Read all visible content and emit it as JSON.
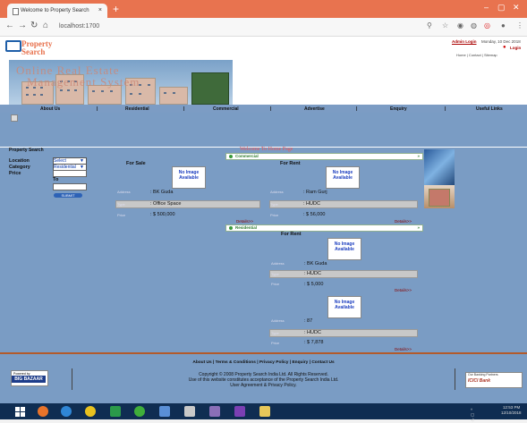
{
  "browser": {
    "tab_title": "Welcome to Property Search",
    "tab_close": "×",
    "new_tab": "+",
    "url": "localhost:1700",
    "win_min": "–",
    "win_max": "▢",
    "win_close": "✕"
  },
  "header": {
    "logo_line1": "Property",
    "logo_line2": "Search",
    "admin_login": "Admin Login",
    "date": "Monday, 10 Dec 2018",
    "login": "Login",
    "top_links": "Home  |  Contact  |  Sitemap"
  },
  "banner": {
    "title_line1": "Online Real Estate",
    "title_line2": "Management System"
  },
  "nav": {
    "items": [
      "About Us",
      "Residential",
      "Commercial",
      "Advertise",
      "Enquiry",
      "Useful Links"
    ],
    "separator": "|"
  },
  "search": {
    "title": "Property Search",
    "location_label": "Location",
    "location_value": "Select",
    "category_label": "Category",
    "category_value": "Residential",
    "price_label": "Price",
    "to_label": "To",
    "submit_label": "SUBMIT"
  },
  "main": {
    "welcome": "Welcome To Home Page",
    "commercial_label": "Commercial",
    "residential_label": "Residential",
    "close_x": "»",
    "for_sale": "For Sale",
    "for_rent": "For Rent",
    "no_image_1": "No Image",
    "no_image_2": "Available",
    "address_label": "Address",
    "type_label": "Type",
    "price_label": "Price",
    "details": "Details>>",
    "commercial_sale": {
      "address": ": BK Guda",
      "type": ": Office Space",
      "price": ": $ 500,000"
    },
    "commercial_rent": {
      "address": ": Ram Gurj",
      "type": ": HUDC",
      "price": ": $ 56,000"
    },
    "residential_rent1": {
      "address": ": BK Guda",
      "type": ": HUDC",
      "price": ": $ 5,000"
    },
    "residential_rent2": {
      "address": ": 87",
      "type": ": HUDC",
      "price": ": $ 7,878"
    }
  },
  "footer": {
    "links": "About Us  |  Terms & Conditions  |  Privacy Policy  |  Enquiry  |  Contact Us",
    "copyright1": "Copyright © 2008 Property Search India Ltd. All Rights Reserved.",
    "copyright2": "Use of this website constitutes acceptance of the Property Search India Ltd.",
    "copyright3": "User Agreement & Privacy Policy.",
    "powered_by": "Powered by",
    "big_bazaar": "BIG BAZAAR",
    "partner": "Our Banking Partners",
    "icici": "ICICI Bank"
  },
  "taskbar": {
    "time": "12:53 PM",
    "date": "12/10/2018"
  }
}
